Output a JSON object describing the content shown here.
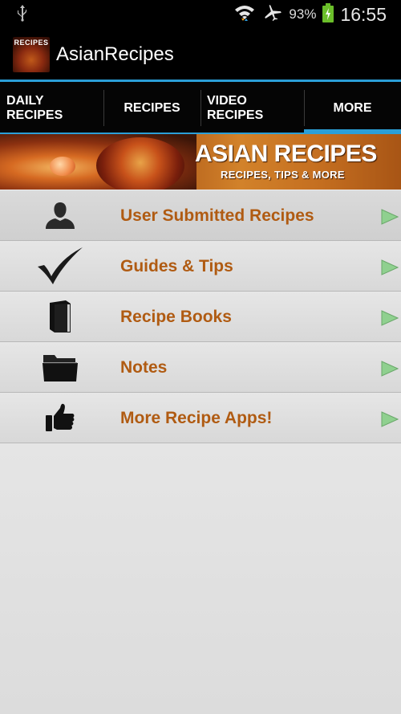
{
  "status_bar": {
    "battery": "93%",
    "time": "16:55",
    "icons": [
      "usb-icon",
      "wifi-icon",
      "airplane-mode-icon",
      "battery-icon"
    ]
  },
  "action_bar": {
    "logo_text": "RECIPES",
    "title": "AsianRecipes"
  },
  "tabs": [
    {
      "label": "DAILY RECIPES",
      "active": false
    },
    {
      "label": "RECIPES",
      "active": false
    },
    {
      "label": "VIDEO RECIPES",
      "active": false
    },
    {
      "label": "MORE",
      "active": true
    }
  ],
  "banner": {
    "title": "ASIAN RECIPES",
    "subtitle": "RECIPES, TIPS & MORE"
  },
  "menu": [
    {
      "label": "User Submitted Recipes",
      "icon": "user-icon"
    },
    {
      "label": "Guides & Tips",
      "icon": "checkmark-icon"
    },
    {
      "label": "Recipe Books",
      "icon": "book-icon"
    },
    {
      "label": "Notes",
      "icon": "folder-icon"
    },
    {
      "label": "More Recipe Apps!",
      "icon": "thumbs-up-icon"
    }
  ],
  "colors": {
    "accent": "#2b9fd8",
    "item_text": "#b05b12",
    "arrow": "#8fd08f"
  }
}
